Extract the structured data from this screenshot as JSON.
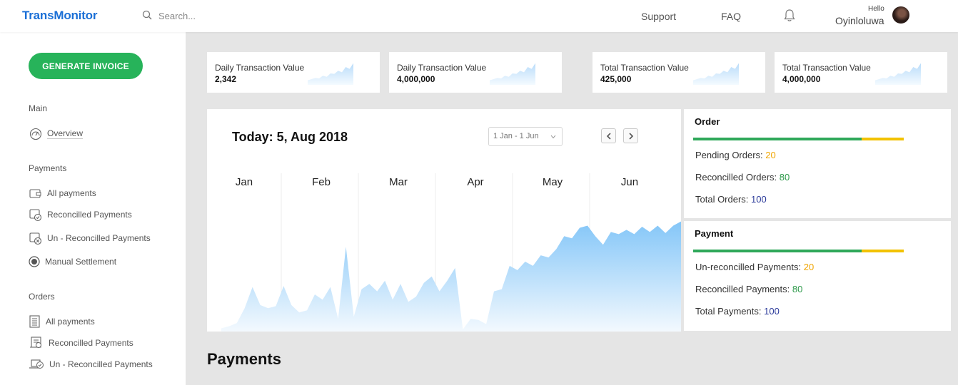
{
  "header": {
    "brand": "TransMonitor",
    "search_placeholder": "Search...",
    "nav": [
      "Support",
      "FAQ"
    ],
    "greeting": "Hello",
    "username": "Oyinloluwa"
  },
  "sidebar": {
    "generate_label": "GENERATE INVOICE",
    "sections": [
      {
        "heading": "Main",
        "items": [
          {
            "label": "Overview",
            "icon": "gauge-icon"
          }
        ]
      },
      {
        "heading": "Payments",
        "items": [
          {
            "label": "All payments",
            "icon": "wallet-icon"
          },
          {
            "label": "Reconcilled Payments",
            "icon": "wallet-check-icon"
          },
          {
            "label": "Un - Reconcilled Payments",
            "icon": "wallet-cross-icon"
          },
          {
            "label": "Manual Settlement",
            "icon": "radio-icon"
          }
        ]
      },
      {
        "heading": "Orders",
        "items": [
          {
            "label": "All payments",
            "icon": "list-icon"
          },
          {
            "label": "Reconcilled Payments",
            "icon": "receipt-icon"
          },
          {
            "label": "Un - Reconcilled Payments",
            "icon": "laptop-check-icon"
          }
        ]
      }
    ]
  },
  "stats": [
    {
      "label": "Daily Transaction Value",
      "value": "2,342"
    },
    {
      "label": "Daily Transaction Value",
      "value": "4,000,000"
    },
    {
      "label": "Total Transaction Value",
      "value": "425,000"
    },
    {
      "label": "Total Transaction Value",
      "value": "4,000,000"
    }
  ],
  "chart": {
    "today": "Today: 5, Aug 2018",
    "range": "1 Jan - 1 Jun",
    "months": [
      "Jan",
      "Feb",
      "Mar",
      "Apr",
      "May",
      "Jun"
    ]
  },
  "chart_data": {
    "type": "area",
    "categories": [
      "Jan",
      "Feb",
      "Mar",
      "Apr",
      "May",
      "Jun"
    ],
    "series": [
      {
        "values": [
          0.03,
          0.05,
          0.08,
          0.22,
          0.42,
          0.25,
          0.22,
          0.24,
          0.43,
          0.25,
          0.18,
          0.2,
          0.35,
          0.3,
          0.42,
          0.12,
          0.8,
          0.14,
          0.4,
          0.45,
          0.38,
          0.48,
          0.3,
          0.45,
          0.28,
          0.33,
          0.46,
          0.52,
          0.38,
          0.48,
          0.6,
          0.02,
          0.12,
          0.11,
          0.07,
          0.38,
          0.4,
          0.62,
          0.58,
          0.66,
          0.62,
          0.72,
          0.7,
          0.78,
          0.9,
          0.88,
          0.98,
          1.0,
          0.9,
          0.82,
          0.94,
          0.92,
          0.96,
          0.92,
          0.99,
          0.94,
          1.0,
          0.93,
          1.0,
          1.04
        ],
        "color": "#8ec9f7"
      }
    ],
    "ylim": [
      0,
      1.2
    ]
  },
  "order_card": {
    "title": "Order",
    "rows": [
      {
        "label": "Pending Orders: ",
        "value": "20",
        "color": "orange"
      },
      {
        "label": "Reconcilled Orders: ",
        "value": "80",
        "color": "green"
      },
      {
        "label": "Total Orders: ",
        "value": "100",
        "color": "blue"
      }
    ],
    "progress": {
      "green": 0.8,
      "yellow": 0.2
    }
  },
  "payment_card": {
    "title": "Payment",
    "rows": [
      {
        "label": "Un-reconcilled Payments: ",
        "value": "20",
        "color": "orange"
      },
      {
        "label": "Reconcilled Payments: ",
        "value": "80",
        "color": "green"
      },
      {
        "label": "Total Payments: ",
        "value": "100",
        "color": "blue"
      }
    ],
    "progress": {
      "green": 0.8,
      "yellow": 0.2
    }
  },
  "section_title": "Payments"
}
